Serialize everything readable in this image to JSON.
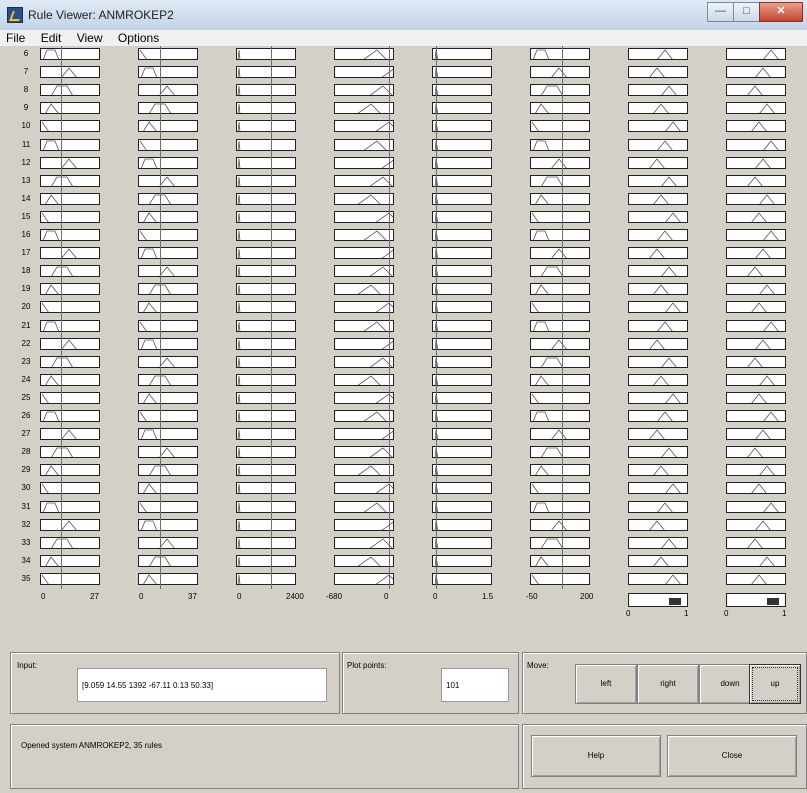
{
  "window": {
    "title": "Rule Viewer: ANMROKEP2"
  },
  "menu": [
    "File",
    "Edit",
    "View",
    "Options"
  ],
  "rules": {
    "numbers": [
      "6",
      "7",
      "8",
      "9",
      "10",
      "11",
      "12",
      "13",
      "14",
      "15",
      "16",
      "17",
      "18",
      "19",
      "20",
      "21",
      "22",
      "23",
      "24",
      "25",
      "26",
      "27",
      "28",
      "29",
      "30",
      "31",
      "32",
      "33",
      "34",
      "35"
    ]
  },
  "inputs_axes": [
    {
      "min": "0",
      "max": "27"
    },
    {
      "min": "0",
      "max": "37"
    },
    {
      "min": "0",
      "max": "2400"
    },
    {
      "min": "-680",
      "max": "0"
    },
    {
      "min": "0",
      "max": "1.5"
    },
    {
      "min": "-50",
      "max": "200"
    }
  ],
  "outputs_axes": [
    {
      "min": "0",
      "max": "1"
    },
    {
      "min": "0",
      "max": "1"
    }
  ],
  "input_panel": {
    "label": "Input:",
    "value": "[9.059 14.55 1392 -67.11 0.13 50.33]"
  },
  "plot_points": {
    "label": "Plot points:",
    "value": "101"
  },
  "move": {
    "label": "Move:",
    "left": "left",
    "right": "right",
    "down": "down",
    "up": "up"
  },
  "status": {
    "text": "Opened system ANMROKEP2, 35 rules"
  },
  "buttons": {
    "help": "Help",
    "close": "Close"
  }
}
